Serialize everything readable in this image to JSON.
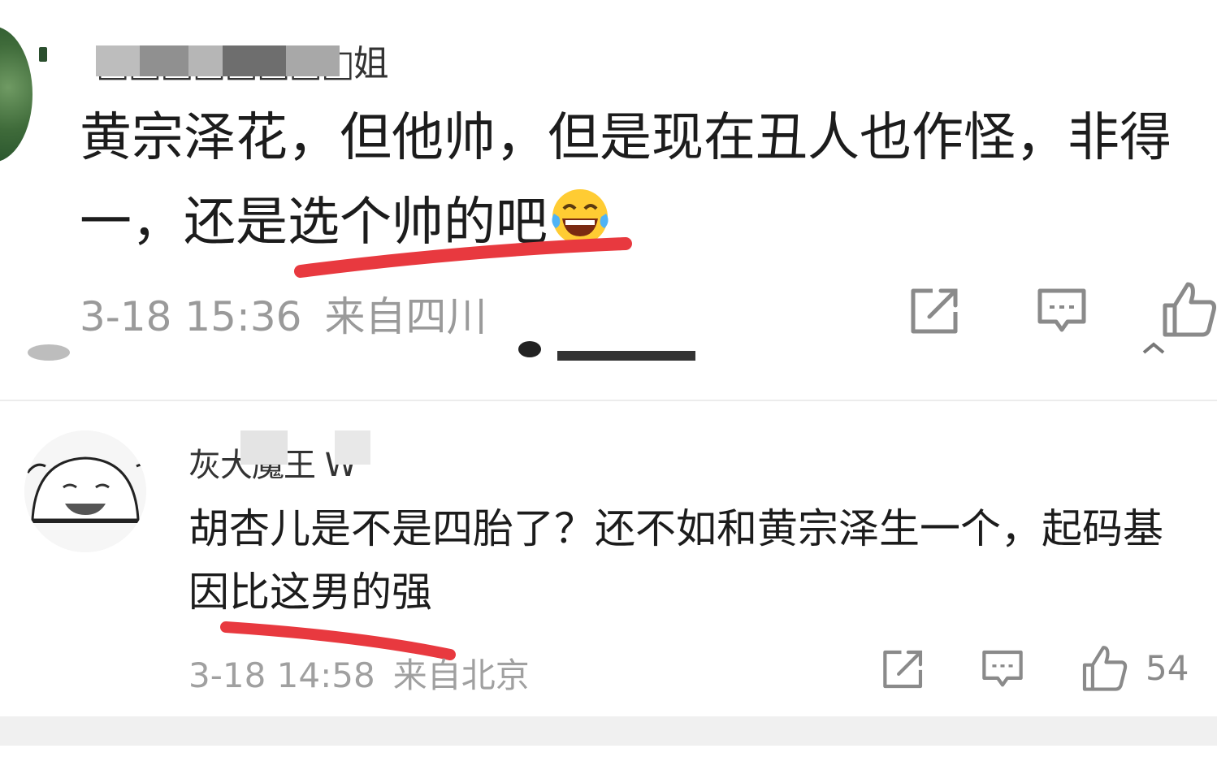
{
  "comments": [
    {
      "username": "□□□□□□□□姐",
      "text": "黄宗泽花，但他帅，但是现在丑人也作怪，非得一，还是选个帅的吧",
      "emoji": "laughing-crying",
      "date": "3-18 15:36",
      "location": "来自四川"
    },
    {
      "username": "灰大魔王 W",
      "text": "胡杏儿是不是四胎了？还不如和黄宗泽生一个，起码基因比这男的强",
      "date": "3-18 14:58",
      "location": "来自北京",
      "like_count": "54"
    }
  ],
  "colors": {
    "underline": "#e8393f",
    "meta": "#9a9a9a",
    "icon": "#8a8a8a"
  }
}
